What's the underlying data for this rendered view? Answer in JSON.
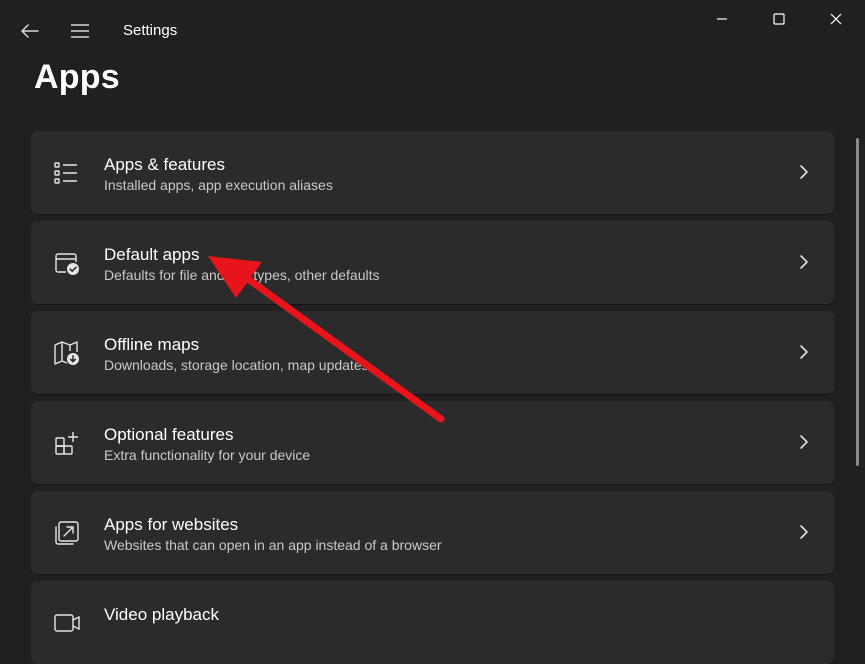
{
  "titlebar": {
    "app_title": "Settings",
    "back_icon": "back-arrow-icon",
    "menu_icon": "hamburger-icon",
    "window_controls": [
      "minimize-icon",
      "maximize-icon",
      "close-icon"
    ]
  },
  "page": {
    "title": "Apps"
  },
  "cards": [
    {
      "title": "Apps & features",
      "subtitle": "Installed apps, app execution aliases",
      "icon": "list-icon"
    },
    {
      "title": "Default apps",
      "subtitle": "Defaults for file and link types, other defaults",
      "icon": "default-apps-icon"
    },
    {
      "title": "Offline maps",
      "subtitle": "Downloads, storage location, map updates",
      "icon": "map-download-icon"
    },
    {
      "title": "Optional features",
      "subtitle": "Extra functionality for your device",
      "icon": "add-grid-icon"
    },
    {
      "title": "Apps for websites",
      "subtitle": "Websites that can open in an app instead of a browser",
      "icon": "open-in-app-icon"
    },
    {
      "title": "Video playback",
      "subtitle": "",
      "icon": "video-icon"
    }
  ],
  "colors": {
    "background": "#202020",
    "card": "#2b2b2b",
    "text_primary": "#ffffff",
    "text_secondary": "#c9c9c9",
    "annotation_arrow": "#e8141b"
  },
  "annotation": {
    "type": "red-arrow",
    "points_to": "Default apps"
  }
}
